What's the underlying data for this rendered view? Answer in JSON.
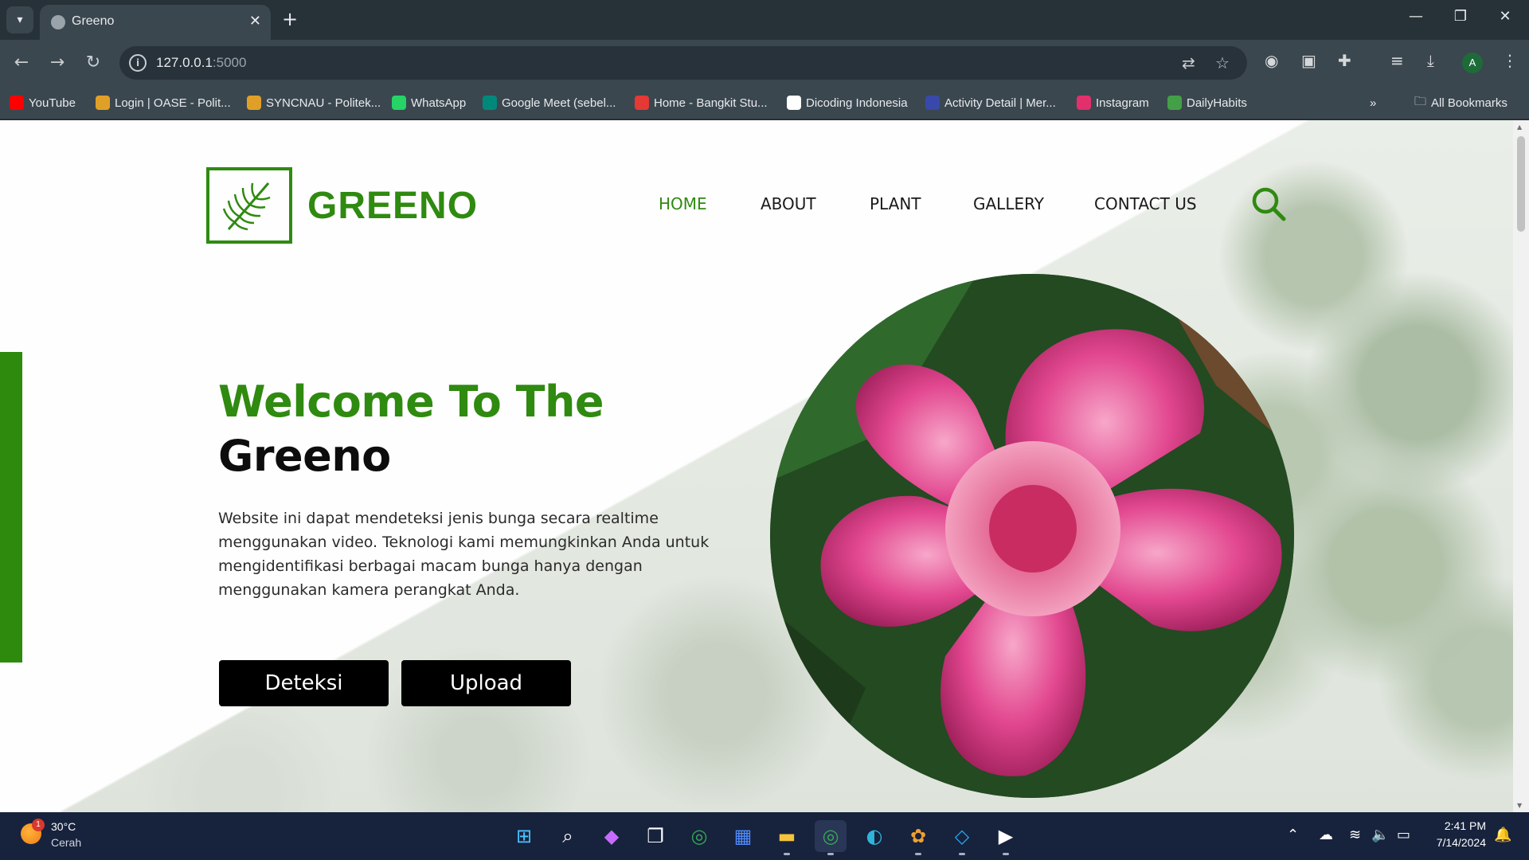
{
  "browser": {
    "tab": {
      "title": "Greeno"
    },
    "url": {
      "host": "127.0.0.1",
      "port": ":5000"
    },
    "bookmarks": [
      {
        "label": "YouTube",
        "color": "#ff0000"
      },
      {
        "label": "Login | OASE - Polit...",
        "color": "#e0a028"
      },
      {
        "label": "SYNCNAU - Politek...",
        "color": "#e0a028"
      },
      {
        "label": "WhatsApp",
        "color": "#25d366"
      },
      {
        "label": "Google Meet (sebel...",
        "color": "#00897b"
      },
      {
        "label": "Home - Bangkit Stu...",
        "color": "#e53935"
      },
      {
        "label": "Dicoding Indonesia",
        "color": "#ffffff"
      },
      {
        "label": "Activity Detail | Mer...",
        "color": "#3949ab"
      },
      {
        "label": "Instagram",
        "color": "#e1306c"
      },
      {
        "label": "DailyHabits",
        "color": "#43a047"
      }
    ],
    "all_bookmarks": "All Bookmarks",
    "profile_initial": "A"
  },
  "site": {
    "brand": "GREENO",
    "nav": [
      "HOME",
      "ABOUT",
      "PLANT",
      "GALLERY",
      "CONTACT US"
    ],
    "active_nav": "HOME",
    "hero": {
      "title_line1": "Welcome To The",
      "title_line2": "Greeno",
      "description": "Website ini dapat mendeteksi jenis bunga secara realtime menggunakan video. Teknologi kami memungkinkan Anda untuk mengidentifikasi berbagai macam bunga hanya dengan menggunakan kamera perangkat Anda.",
      "buttons": [
        "Deteksi",
        "Upload"
      ]
    },
    "colors": {
      "accent": "#2f8a10",
      "button_bg": "#000000",
      "flower_pink": "#e2478f"
    }
  },
  "taskbar": {
    "weather": {
      "temp": "30°C",
      "desc": "Cerah",
      "badge": "1"
    },
    "apps": [
      "start-icon",
      "search-icon",
      "copilot-icon",
      "task-view-icon",
      "chrome-icon",
      "store-icon",
      "file-explorer-icon",
      "chrome-profile-icon",
      "edge-icon",
      "game-icon",
      "vscode-icon",
      "media-player-icon"
    ],
    "clock": {
      "time": "2:41 PM",
      "date": "7/14/2024"
    }
  }
}
